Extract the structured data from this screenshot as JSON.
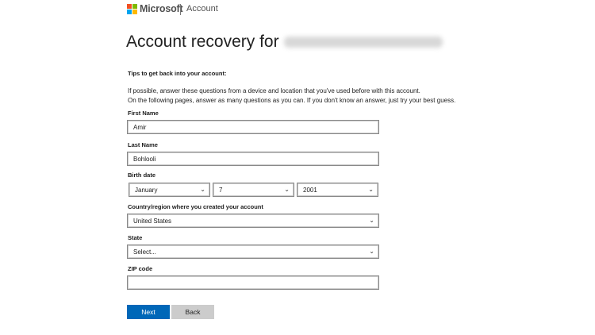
{
  "header": {
    "brand": "Microsoft",
    "section": "Account",
    "logo_colors": [
      "#f25022",
      "#7fba00",
      "#00a4ef",
      "#ffb900"
    ]
  },
  "title": "Account recovery for",
  "tips": {
    "heading": "Tips to get back into your account:",
    "line1": "If possible, answer these questions from a device and location that you've used before with this account.",
    "line2": "On the following pages, answer as many questions as you can. If you don't know an answer, just try your best guess."
  },
  "form": {
    "first_name": {
      "label": "First Name",
      "value": "Amir"
    },
    "last_name": {
      "label": "Last Name",
      "value": "Bohlooli"
    },
    "birth_date": {
      "label": "Birth date",
      "month": "January",
      "day": "7",
      "year": "2001"
    },
    "country": {
      "label": "Country/region where you created your account",
      "value": "United States"
    },
    "state": {
      "label": "State",
      "value": "Select..."
    },
    "zip": {
      "label": "ZIP code",
      "value": ""
    }
  },
  "buttons": {
    "next": "Next",
    "back": "Back"
  }
}
